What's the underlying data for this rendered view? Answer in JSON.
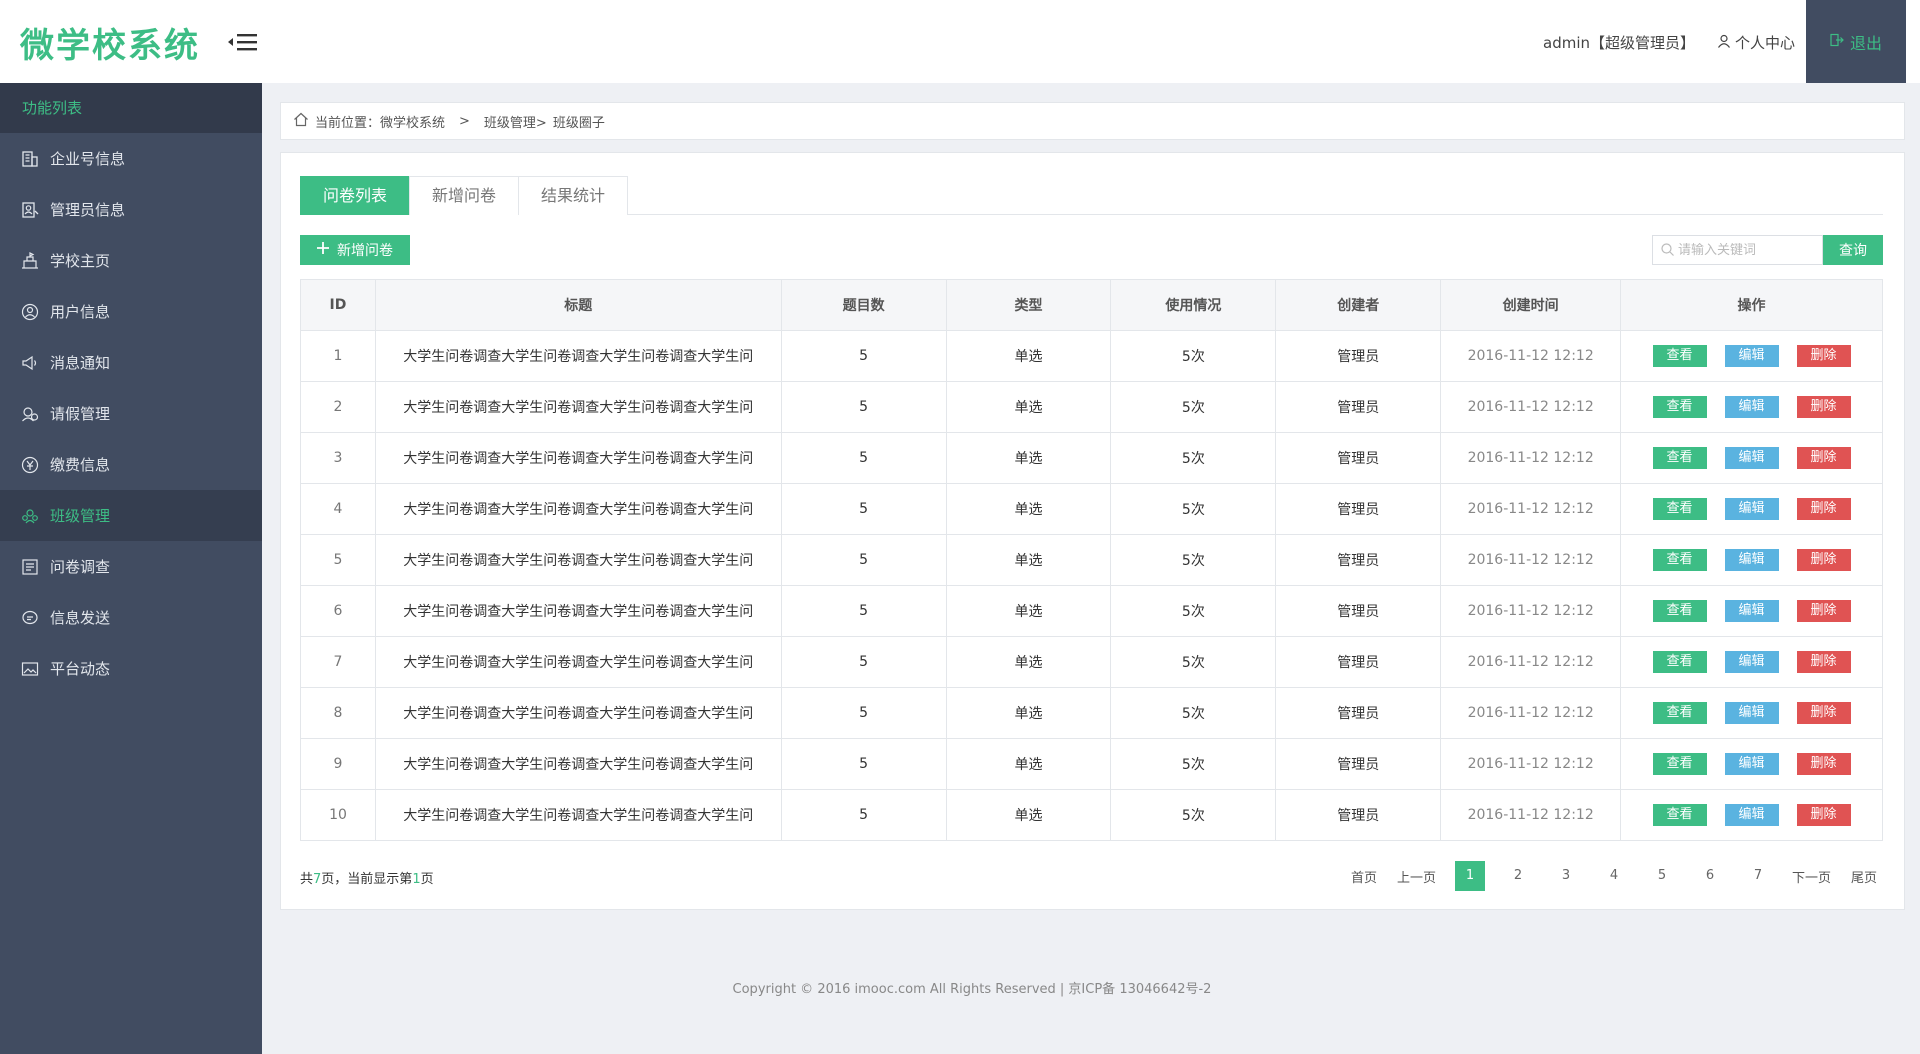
{
  "header": {
    "logo": "微学校系统",
    "user": "admin【超级管理员】",
    "user_center": "个人中心",
    "logout": "退出"
  },
  "sidebar": {
    "title": "功能列表",
    "items": [
      {
        "label": "企业号信息",
        "icon": "building-icon"
      },
      {
        "label": "管理员信息",
        "icon": "admin-icon"
      },
      {
        "label": "学校主页",
        "icon": "school-icon"
      },
      {
        "label": "用户信息",
        "icon": "user-icon"
      },
      {
        "label": "消息通知",
        "icon": "megaphone-icon"
      },
      {
        "label": "请假管理",
        "icon": "leave-icon"
      },
      {
        "label": "缴费信息",
        "icon": "payment-icon"
      },
      {
        "label": "班级管理",
        "icon": "class-icon"
      },
      {
        "label": "问卷调查",
        "icon": "survey-icon"
      },
      {
        "label": "信息发送",
        "icon": "message-icon"
      },
      {
        "label": "平台动态",
        "icon": "image-icon"
      }
    ],
    "active_index": 7
  },
  "breadcrumb": {
    "prefix": "当前位置：微学校系统",
    "sep": ">",
    "part2": "班级管理>",
    "part3": "班级圈子"
  },
  "tabs": [
    "问卷列表",
    "新增问卷",
    "结果统计"
  ],
  "toolbar": {
    "add_label": "新增问卷",
    "search_placeholder": "请输入关键词",
    "search_label": "查询"
  },
  "table": {
    "headers": [
      "ID",
      "标题",
      "题目数",
      "类型",
      "使用情况",
      "创建者",
      "创建时间",
      "操作"
    ],
    "rows": [
      {
        "id": "1",
        "title": "大学生问卷调查大学生问卷调查大学生问卷调查大学生问",
        "count": "5",
        "type": "单选",
        "usage": "5次",
        "creator": "管理员",
        "time": "2016-11-12  12:12"
      },
      {
        "id": "2",
        "title": "大学生问卷调查大学生问卷调查大学生问卷调查大学生问",
        "count": "5",
        "type": "单选",
        "usage": "5次",
        "creator": "管理员",
        "time": "2016-11-12  12:12"
      },
      {
        "id": "3",
        "title": "大学生问卷调查大学生问卷调查大学生问卷调查大学生问",
        "count": "5",
        "type": "单选",
        "usage": "5次",
        "creator": "管理员",
        "time": "2016-11-12  12:12"
      },
      {
        "id": "4",
        "title": "大学生问卷调查大学生问卷调查大学生问卷调查大学生问",
        "count": "5",
        "type": "单选",
        "usage": "5次",
        "creator": "管理员",
        "time": "2016-11-12  12:12"
      },
      {
        "id": "5",
        "title": "大学生问卷调查大学生问卷调查大学生问卷调查大学生问",
        "count": "5",
        "type": "单选",
        "usage": "5次",
        "creator": "管理员",
        "time": "2016-11-12  12:12"
      },
      {
        "id": "6",
        "title": "大学生问卷调查大学生问卷调查大学生问卷调查大学生问",
        "count": "5",
        "type": "单选",
        "usage": "5次",
        "creator": "管理员",
        "time": "2016-11-12  12:12"
      },
      {
        "id": "7",
        "title": "大学生问卷调查大学生问卷调查大学生问卷调查大学生问",
        "count": "5",
        "type": "单选",
        "usage": "5次",
        "creator": "管理员",
        "time": "2016-11-12  12:12"
      },
      {
        "id": "8",
        "title": "大学生问卷调查大学生问卷调查大学生问卷调查大学生问",
        "count": "5",
        "type": "单选",
        "usage": "5次",
        "creator": "管理员",
        "time": "2016-11-12  12:12"
      },
      {
        "id": "9",
        "title": "大学生问卷调查大学生问卷调查大学生问卷调查大学生问",
        "count": "5",
        "type": "单选",
        "usage": "5次",
        "creator": "管理员",
        "time": "2016-11-12  12:12"
      },
      {
        "id": "10",
        "title": "大学生问卷调查大学生问卷调查大学生问卷调查大学生问",
        "count": "5",
        "type": "单选",
        "usage": "5次",
        "creator": "管理员",
        "time": "2016-11-12  12:12"
      }
    ],
    "ops": {
      "view": "查看",
      "edit": "编辑",
      "delete": "删除"
    }
  },
  "pagination": {
    "info_pre": "共",
    "total": "7",
    "info_mid": "页，当前显示第",
    "current": "1",
    "info_post": "页",
    "first": "首页",
    "prev": "上一页",
    "pages": [
      "1",
      "2",
      "3",
      "4",
      "5",
      "6",
      "7"
    ],
    "next": "下一页",
    "last": "尾页"
  },
  "footer": {
    "copyright": "Copyright © 2016 imooc.com All Rights Reserved | 京ICP备 13046642号-2"
  },
  "colors": {
    "accent": "#3dbd85",
    "sidebar_bg": "#414c61",
    "edit_blue": "#5ab3e0",
    "delete_red": "#e05353"
  }
}
